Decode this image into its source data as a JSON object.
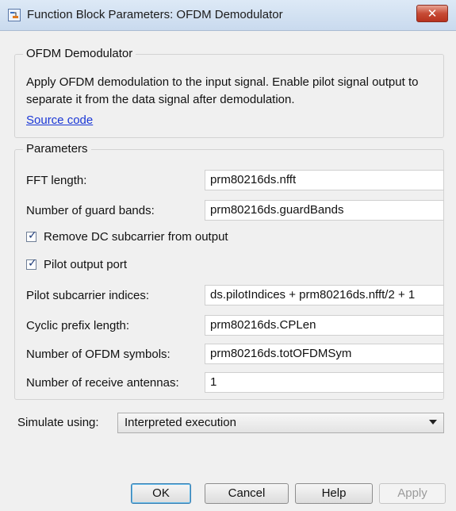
{
  "window": {
    "title": "Function Block Parameters: OFDM Demodulator",
    "close_label": "✕"
  },
  "block_group": {
    "legend": "OFDM Demodulator",
    "description": "Apply OFDM demodulation to the input signal. Enable pilot signal output to separate it from the data signal after demodulation.",
    "link": "Source code"
  },
  "parameters_group": {
    "legend": "Parameters",
    "fft_length": {
      "label": "FFT length:",
      "value": "prm80216ds.nfft"
    },
    "guard_bands": {
      "label": "Number of guard bands:",
      "value": "prm80216ds.guardBands"
    },
    "remove_dc": {
      "label": "Remove DC subcarrier from output",
      "checked": true
    },
    "pilot_port": {
      "label": "Pilot output port",
      "checked": true
    },
    "pilot_indices": {
      "label": "Pilot subcarrier indices:",
      "value": "ds.pilotIndices + prm80216ds.nfft/2 + 1"
    },
    "cp_length": {
      "label": "Cyclic prefix length:",
      "value": "prm80216ds.CPLen"
    },
    "ofdm_symbols": {
      "label": "Number of OFDM symbols:",
      "value": "prm80216ds.totOFDMSym"
    },
    "rx_antennas": {
      "label": "Number of receive antennas:",
      "value": "1"
    }
  },
  "simulate": {
    "label": "Simulate using:",
    "selected": "Interpreted execution"
  },
  "buttons": {
    "ok": "OK",
    "cancel": "Cancel",
    "help": "Help",
    "apply": "Apply"
  }
}
